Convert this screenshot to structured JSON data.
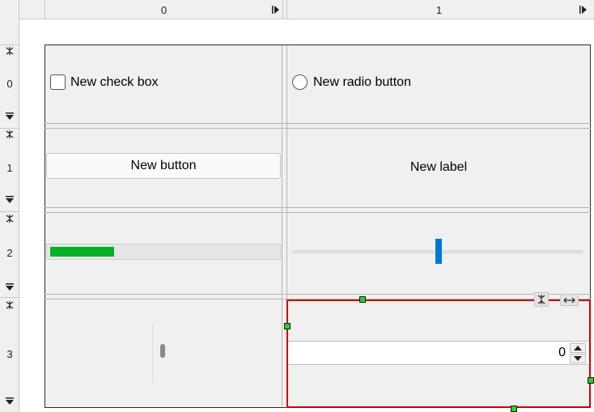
{
  "columns": [
    {
      "label": "0"
    },
    {
      "label": "1"
    }
  ],
  "rows": [
    {
      "label": "0"
    },
    {
      "label": "1"
    },
    {
      "label": "2"
    },
    {
      "label": "3"
    }
  ],
  "widgets": {
    "checkbox": {
      "label": "New check box",
      "checked": false
    },
    "radio": {
      "label": "New radio button",
      "checked": false
    },
    "button": {
      "label": "New button"
    },
    "label": {
      "text": "New label"
    },
    "progress": {
      "value_fraction": 0.28
    },
    "slider": {
      "value_fraction": 0.5
    },
    "spinbox": {
      "value": "0"
    }
  },
  "colors": {
    "selection": "#d40000",
    "handle": "#17d62f",
    "progress_fill": "#06b025",
    "slider_handle": "#0078d7"
  },
  "icons": [
    "column-resize-arrow-icon",
    "row-collapse-icon",
    "row-expand-icon",
    "spin-up-icon",
    "spin-down-icon",
    "collapse-vertical-icon",
    "expand-horizontal-icon"
  ]
}
